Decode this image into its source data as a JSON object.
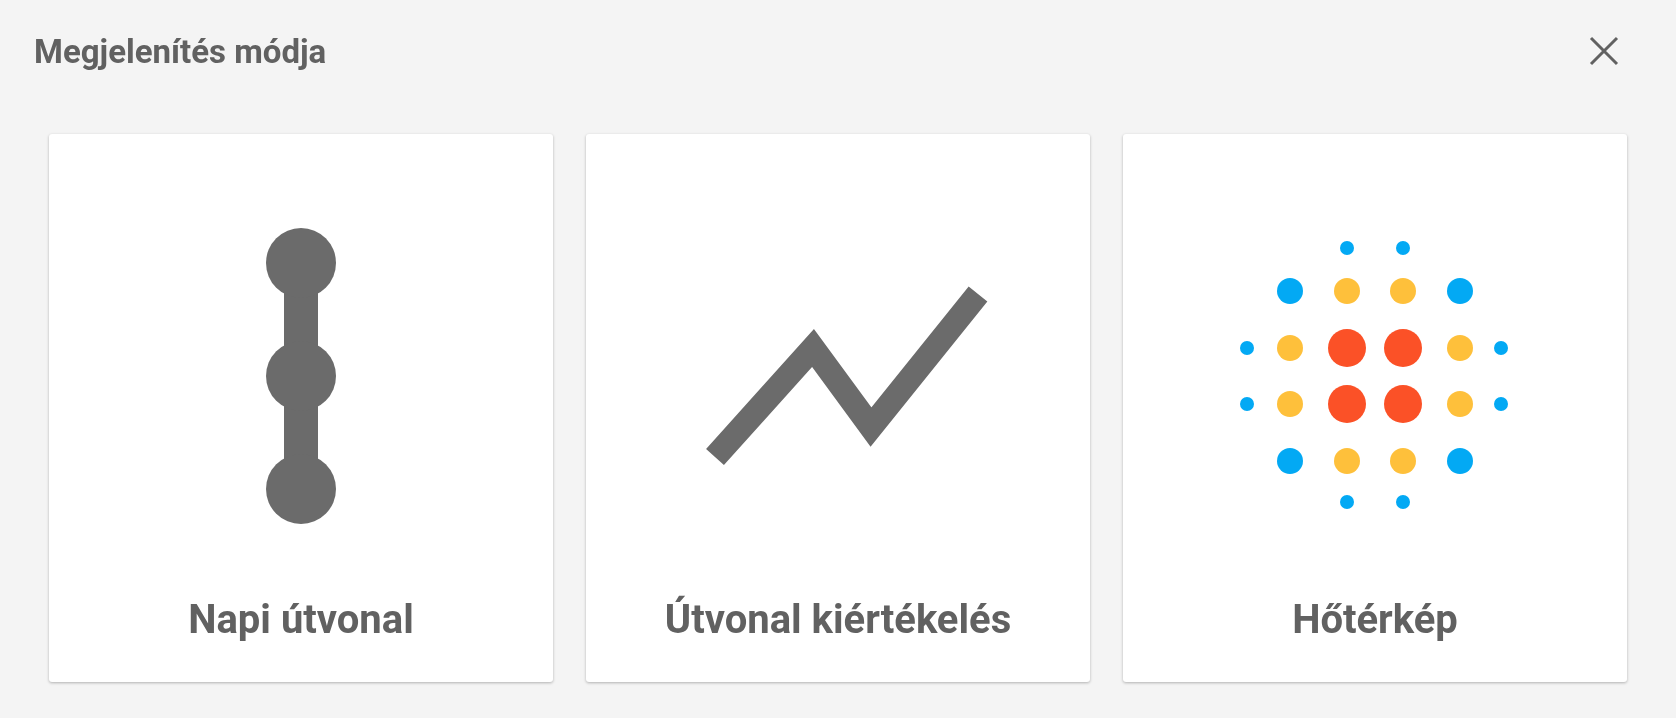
{
  "dialog": {
    "title": "Megjelenítés módja"
  },
  "cards": [
    {
      "label": "Napi útvonal",
      "kind": "chain"
    },
    {
      "label": "Útvonal kiértékelés",
      "kind": "trend"
    },
    {
      "label": "Hőtérkép",
      "kind": "heat"
    }
  ]
}
